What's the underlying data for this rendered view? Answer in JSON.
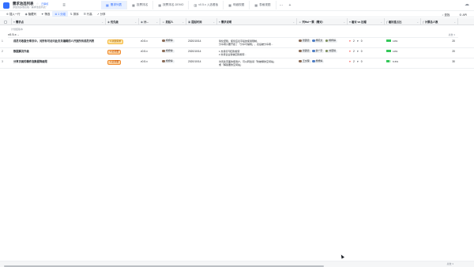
{
  "app": {
    "title": "需求池选列表",
    "tag": "已审核",
    "subtitle": "添加到多维表格: \"需求池选列表\""
  },
  "view_tabs": [
    {
      "label": "需求列表",
      "icon": "grid-icon",
      "active": true
    },
    {
      "label": "投票排名",
      "icon": "grid-icon",
      "active": false
    },
    {
      "label": "按票排名-DEMO",
      "icon": "grid-icon",
      "active": false
    },
    {
      "label": "v0.5.x 入选看板",
      "icon": "kanban-icon",
      "active": false
    },
    {
      "label": "明细视图",
      "icon": "grid-icon",
      "active": false
    },
    {
      "label": "表格视图",
      "icon": "grid-icon",
      "active": false
    }
  ],
  "toolbar": {
    "items": [
      {
        "label": "插入一行",
        "icon": "plus-icon",
        "active": false
      },
      {
        "label": "隐藏列",
        "icon": "eye-icon",
        "active": false
      },
      {
        "label": "筛选",
        "icon": "filter-icon",
        "active": false
      },
      {
        "label": "1 分组",
        "icon": "group-icon",
        "active": true
      },
      {
        "label": "排序",
        "icon": "sort-icon",
        "active": false
      },
      {
        "label": "行高",
        "icon": "row-height-icon",
        "active": false
      },
      {
        "label": "分享",
        "icon": "share-icon",
        "active": false
      }
    ],
    "right": [
      {
        "label": "查找",
        "icon": "search-icon"
      },
      {
        "label": "API",
        "icon": "api-icon"
      }
    ]
  },
  "columns": [
    {
      "label": "需求点",
      "icon": "text-icon"
    },
    {
      "label": "优先级",
      "icon": "select-icon"
    },
    {
      "label": "计...",
      "icon": "select-icon"
    },
    {
      "label": "发起人",
      "icon": "person-icon"
    },
    {
      "label": "提起时间",
      "icon": "calendar-icon"
    },
    {
      "label": "需求说明",
      "icon": "text-icon"
    },
    {
      "label": "列Hui一票（需对）",
      "icon": "person-icon"
    },
    {
      "label": "看对 vs 拉帽",
      "icon": "vote-icon"
    },
    {
      "label": "看好度占比",
      "icon": "formula-icon"
    },
    {
      "label": "计票总人数",
      "icon": "formula-icon"
    }
  ],
  "group": {
    "meta": "计划结版本",
    "title": "v0.5.x",
    "count": "总数 3"
  },
  "rows": [
    {
      "num": "1",
      "title": "成员可收版分享页中，对所有可访问此页并编辑的人开放所有成员列表",
      "priority": "3-关键需求",
      "priority_style": "b1",
      "plan": "v0.5.x",
      "initiator": "杨梓婷",
      "date": "2020/10/14",
      "desc": "简化逻辑，使您应表字段的使用限制，\n分享者只要开启了「分享可编辑」，表后被分享者...",
      "voters": [
        "张翼德",
        "杨晓文",
        "杨梓婷"
      ],
      "hearts": "2",
      "likes": "0",
      "ratio": "10%",
      "ratio_pct": 10,
      "total": "20"
    },
    {
      "num": "2",
      "title": "数据解决升级",
      "priority": "2-必须要",
      "priority_style": "b2",
      "plan": "v0.5.x",
      "initiator": "杨梓婷",
      "date": "2020/10/14",
      "desc": "1.支持打印回到搜索\n2.支持企业微信回到搜索...",
      "voters": [
        "张翼德",
        "梦广宇",
        "刘若晴"
      ],
      "hearts": "2",
      "likes": "0",
      "ratio": "10%",
      "ratio_pct": 10,
      "total": "20"
    },
    {
      "num": "3",
      "title": "分享页面的稿件指数据降级限",
      "priority": "2-必须要",
      "priority_style": "b2",
      "plan": "v0.5.x",
      "initiator": "杨梓婷",
      "date": "2020/10/14",
      "desc": "访问此页面的使用户，可以转给领「防被爆的空间站」\n或「解答要的空间站」",
      "voters": [
        "王文程",
        "杨梓婷"
      ],
      "hearts": "2",
      "likes": "0",
      "ratio": "6.6%",
      "ratio_pct": 6.6,
      "total": "30"
    }
  ],
  "footer": {
    "count": "总数 3"
  }
}
